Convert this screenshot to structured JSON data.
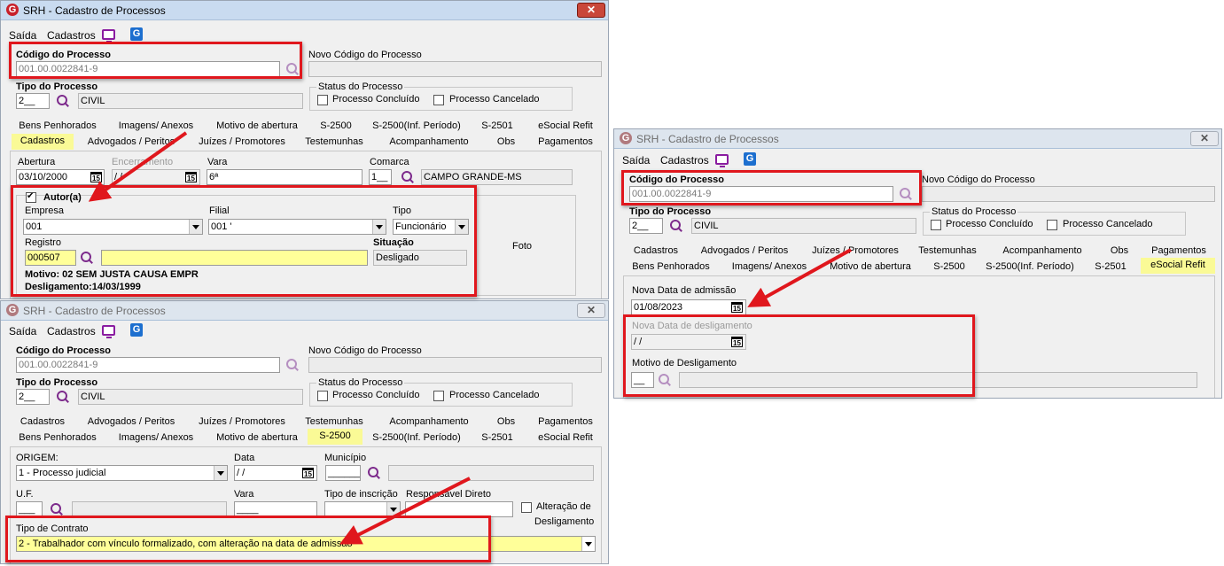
{
  "app_title": "SRH - Cadastro de Processos",
  "close_glyph": "✕",
  "menu": {
    "saida": "Saída",
    "cadastros": "Cadastros"
  },
  "labels": {
    "codigo": "Código do Processo",
    "novo_codigo": "Novo Código do Processo",
    "tipo_processo": "Tipo do Processo",
    "status": "Status do Processo",
    "concluido": "Processo Concluído",
    "cancelado": "Processo Cancelado"
  },
  "values": {
    "codigo": "001.00.0022841-9",
    "tipo_code": "2__",
    "tipo_desc": "CIVIL"
  },
  "tabs_row1": [
    "Bens Penhorados",
    "Imagens/ Anexos",
    "Motivo de abertura",
    "S-2500",
    "S-2500(Inf. Período)",
    "S-2501",
    "eSocial Refit"
  ],
  "tabs_row2": [
    "Cadastros",
    "Advogados / Peritos",
    "Juízes / Promotores",
    "Testemunhas",
    "Acompanhamento",
    "Obs",
    "Pagamentos"
  ],
  "cad_tab": {
    "abertura_label": "Abertura",
    "abertura": "03/10/2000",
    "encerramento_label": "Encerramento",
    "encerramento": "/ /",
    "vara_label": "Vara",
    "vara": "6ª",
    "comarca_label": "Comarca",
    "comarca_code": "1__",
    "comarca_name": "CAMPO GRANDE-MS",
    "autor_label": "Autor(a)",
    "empresa_label": "Empresa",
    "empresa": "001",
    "filial_label": "Filial",
    "filial": "001 '",
    "tipo_label": "Tipo",
    "tipo": "Funcionário",
    "registro_label": "Registro",
    "registro": "000507",
    "situacao_label": "Situação",
    "situacao": "Desligado",
    "motivo": "Motivo: 02 SEM JUSTA CAUSA EMPR",
    "desligamento": "Desligamento:14/03/1999",
    "foto": "Foto"
  },
  "s2500_tab": {
    "origem_label": "ORIGEM:",
    "origem": "1 - Processo judicial",
    "data_label": "Data",
    "data": "/ /",
    "municipio_label": "Município",
    "municipio_code": "______",
    "uf_label": "U.F.",
    "uf": "___",
    "vara_label": "Vara",
    "vara": "____",
    "tipo_inscricao_label": "Tipo de inscrição",
    "responsavel_label": "Responsável Direto",
    "alteracao_label_1": "Alteração de",
    "alteracao_label_2": "Desligamento",
    "tipo_contrato_label": "Tipo de Contrato",
    "tipo_contrato": "2 - Trabalhador com vínculo formalizado, com alteração na data de admissão"
  },
  "refit_tab": {
    "nova_admissao_label": "Nova Data de admissão",
    "nova_admissao": "01/08/2023",
    "nova_deslig_label": "Nova Data de desligamento",
    "nova_deslig": "/ /",
    "motivo_label": "Motivo de Desligamento",
    "motivo_code": "__"
  },
  "cal_glyph": "15",
  "g_glyph": "G",
  "colors": {
    "highlight": "#e0171d",
    "selected_tab": "#fafa96",
    "title_active": "#c9dbf0"
  }
}
